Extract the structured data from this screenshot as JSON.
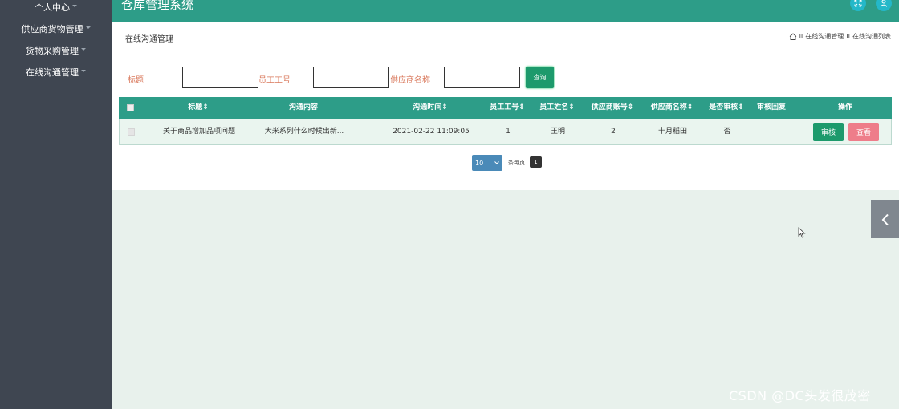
{
  "app": {
    "title": "仓库管理系统"
  },
  "sidebar": {
    "items": [
      {
        "label": "个人中心"
      },
      {
        "label": "供应商货物管理"
      },
      {
        "label": "货物采购管理"
      },
      {
        "label": "在线沟通管理"
      }
    ]
  },
  "header": {
    "icons": [
      "fullscreen-icon",
      "user-icon"
    ],
    "accent": "#2d9d88"
  },
  "page": {
    "title": "在线沟通管理",
    "breadcrumb": [
      "在线沟通管理",
      "在线沟通列表"
    ],
    "breadcrumb_sep": "II"
  },
  "search": {
    "title_label": "标题",
    "staff_no_label": "员工工号",
    "supplier_name_label": "供应商名称",
    "title_value": "",
    "staff_no_value": "",
    "supplier_name_value": "",
    "button_label": "查询"
  },
  "table": {
    "columns": [
      "标题",
      "沟通内容",
      "沟通时间",
      "员工工号",
      "员工姓名",
      "供应商账号",
      "供应商名称",
      "是否审核",
      "审核回复",
      "操作"
    ],
    "sortable_mark": "⇕",
    "rows": [
      {
        "title": "关于商品增加品项问题",
        "content": "大米系列什么时候出新...",
        "time": "2021-02-22 11:09:05",
        "staff_no": "1",
        "staff_name": "王明",
        "supplier_account": "2",
        "supplier_name": "十月稻田",
        "audited": "否",
        "reply": "",
        "actions": {
          "audit": "审核",
          "view": "查看"
        }
      }
    ]
  },
  "pagination": {
    "page_size": "10",
    "per_page_label": "条每页",
    "current_page": "1"
  },
  "watermark": "CSDN @DC头发很茂密",
  "colors": {
    "sidebar": "#3f4651",
    "primary": "#2d9d88",
    "button_green": "#1d9a6c",
    "button_pink": "#ee7d8a",
    "label_orange": "#d9775a"
  }
}
